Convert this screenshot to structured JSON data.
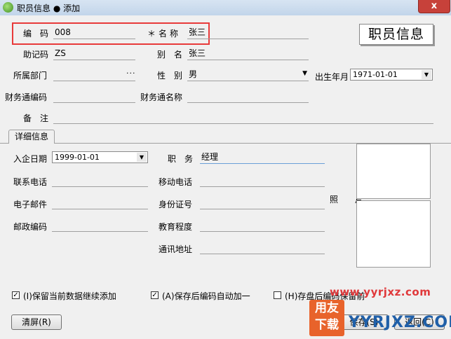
{
  "window": {
    "title": "职员信息 ● 添加",
    "close_label": "x"
  },
  "form": {
    "code": {
      "label": "编码",
      "value": "008"
    },
    "name": {
      "label": "＊名称",
      "value": "张三"
    },
    "mnemonic": {
      "label": "助记码",
      "value": "ZS"
    },
    "alias": {
      "label": "别名",
      "value": "张三"
    },
    "department": {
      "label": "所属部门",
      "value": "",
      "button": "···"
    },
    "gender": {
      "label": "性别",
      "value": "男"
    },
    "birth": {
      "label": "出生年月",
      "value": "1971-01-01"
    },
    "finance_code": {
      "label": "财务通编码",
      "value": ""
    },
    "finance_name": {
      "label": "财务通名称",
      "value": ""
    },
    "remark": {
      "label": "备注",
      "value": ""
    }
  },
  "banner": "职员信息",
  "tab": {
    "label": "详细信息"
  },
  "detail": {
    "join_date": {
      "label": "入企日期",
      "value": "1999-01-01"
    },
    "position": {
      "label": "职务",
      "value": "经理"
    },
    "phone": {
      "label": "联系电话",
      "value": ""
    },
    "mobile": {
      "label": "移动电话",
      "value": ""
    },
    "email": {
      "label": "电子邮件",
      "value": ""
    },
    "id_card": {
      "label": "身份证号",
      "value": ""
    },
    "postcode": {
      "label": "邮政编码",
      "value": ""
    },
    "education": {
      "label": "教育程度",
      "value": ""
    },
    "address": {
      "label": "通讯地址",
      "value": ""
    },
    "photo_label": "照 片"
  },
  "options": {
    "keep_data": {
      "label": "(I)保留当前数据继续添加",
      "checked": true
    },
    "auto_increment": {
      "label": "(A)保存后编码自动加一",
      "checked": true
    },
    "save_keep": {
      "label": "(H)存盘后编码保留前",
      "checked": false
    }
  },
  "buttons": {
    "clear": "清屏(R)",
    "save": "保存(S)",
    "back": "返回(C)"
  },
  "watermark": {
    "url": "www.yyrjxz.com",
    "logo": "用友下载",
    "big": "YYRJXZ.COM"
  }
}
